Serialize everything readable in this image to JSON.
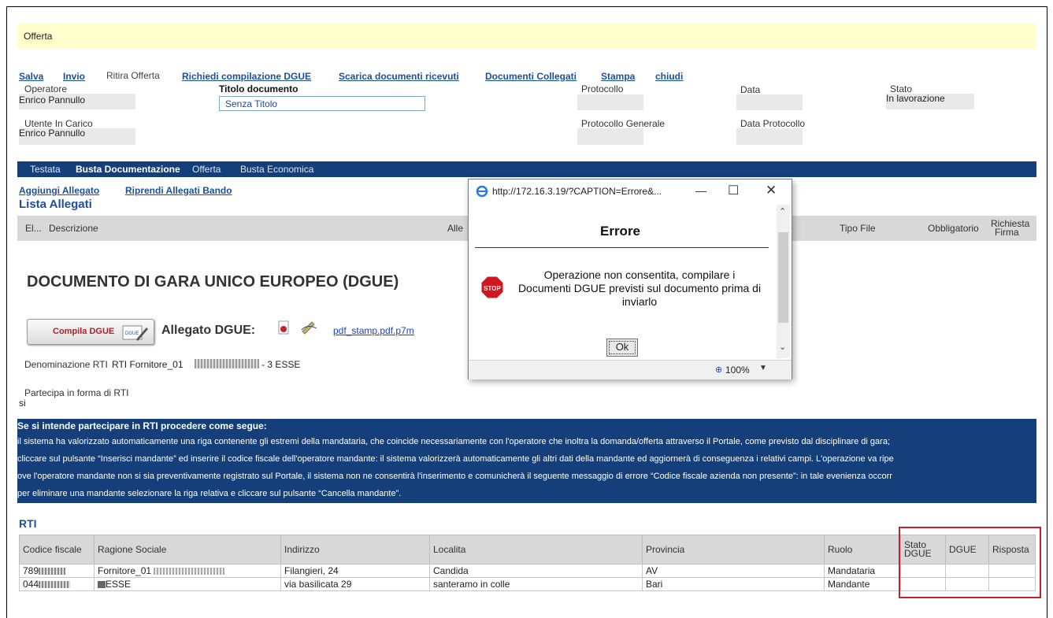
{
  "banner": {
    "title": "Offerta"
  },
  "toolbar": {
    "salva": "Salva",
    "invio": "Invio",
    "ritira": "Ritira Offerta",
    "richiedi": "Richiedi compilazione DGUE",
    "scarica": "Scarica documenti ricevuti",
    "collegati": "Documenti Collegati",
    "stampa": "Stampa",
    "chiudi": "chiudi"
  },
  "fields": {
    "operatore_label": "Operatore",
    "operatore_value": "Enrico Pannullo",
    "titolo_label": "Titolo documento",
    "titolo_value": "Senza Titolo",
    "protocollo_label": "Protocollo",
    "data_label": "Data",
    "stato_label": "Stato",
    "stato_value": "In lavorazione",
    "utente_label": "Utente In Carico",
    "utente_value": "Enrico Pannullo",
    "protgen_label": "Protocollo Generale",
    "dataprot_label": "Data Protocollo"
  },
  "tabs": [
    "Testata",
    "Busta Documentazione",
    "Offerta",
    "Busta Economica"
  ],
  "allegati": {
    "aggiungi": "Aggiungi Allegato",
    "riprendi": "Riprendi Allegati Bando",
    "title": "Lista Allegati",
    "columns": {
      "el": "El...",
      "descrizione": "Descrizione",
      "allegato": "Alle",
      "tipo": "Tipo File",
      "obbligatorio": "Obbligatorio",
      "richiesta": "Richiesta",
      "firma": "Firma"
    }
  },
  "dgue": {
    "heading": "DOCUMENTO DI GARA UNICO EUROPEO (DGUE)",
    "compila": "Compila DGUE",
    "compila_icon_text": "DGUE",
    "allegato_label": "Allegato DGUE:",
    "file_link": "pdf_stamp.pdf.p7m",
    "denominazione_label": "Denominazione RTI",
    "denominazione_value": "RTI Fornitore_01",
    "denominazione_suffix": "- 3 ESSE",
    "partecipa_label": "Partecipa in forma di RTI",
    "partecipa_value": "si"
  },
  "instructions": {
    "title": "Se si intende partecipare in RTI procedere come segue:",
    "lines": [
      "il sistema ha valorizzato automaticamente una riga contenente gli estremi della mandataria, che coincide necessariamente con l'operatore che inoltra la domanda/offerta attraverso il Portale, come previsto dal disciplinare di gara;",
      "cliccare sul pulsante “Inserisci mandante” ed inserire il codice fiscale dell'operatore mandante: il sistema valorizzerà automaticamente gli altri dati della mandante ed aggiornerà di conseguenza i relativi campi. L'operazione va ripe",
      "ove l'operatore mandante non si sia preventivamente registrato sul Portale, il sistema non ne consentirà l'inserimento e comunicherà il seguente messaggio di errore “Codice fiscale azienda non presente”: in tale evenienza occorr",
      "per eliminare una mandante selezionare la riga relativa e cliccare sul pulsante “Cancella mandante”."
    ]
  },
  "rti": {
    "title": "RTI",
    "columns": [
      "Codice fiscale",
      "Ragione Sociale",
      "Indirizzo",
      "Localita",
      "Provincia",
      "Ruolo",
      "Stato DGUE",
      "DGUE",
      "Risposta"
    ],
    "rows": [
      {
        "cf": "789",
        "rs": "Fornitore_01",
        "ind": "Filangieri, 24",
        "loc": "Candida",
        "prov": "AV",
        "ruolo": "Mandataria",
        "stato": "",
        "dgue": "",
        "risp": ""
      },
      {
        "cf": "044",
        "rs": "ESSE",
        "ind": "via basilicata 29",
        "loc": "santeramo in colle",
        "prov": "Bari",
        "ruolo": "Mandante",
        "stato": "",
        "dgue": "",
        "risp": ""
      }
    ]
  },
  "dialog": {
    "url": "http://172.16.3.19/?CAPTION=Errore&...",
    "title": "Errore",
    "message": "Operazione non consentita, compilare i Documenti DGUE previsti sul documento prima di inviarlo",
    "stop_text": "STOP",
    "ok": "Ok",
    "zoom": "100%"
  },
  "colors": {
    "accent": "#143f7a",
    "link": "#1c4f9c",
    "highlight": "#c8202a",
    "banner": "#ffffcc"
  }
}
